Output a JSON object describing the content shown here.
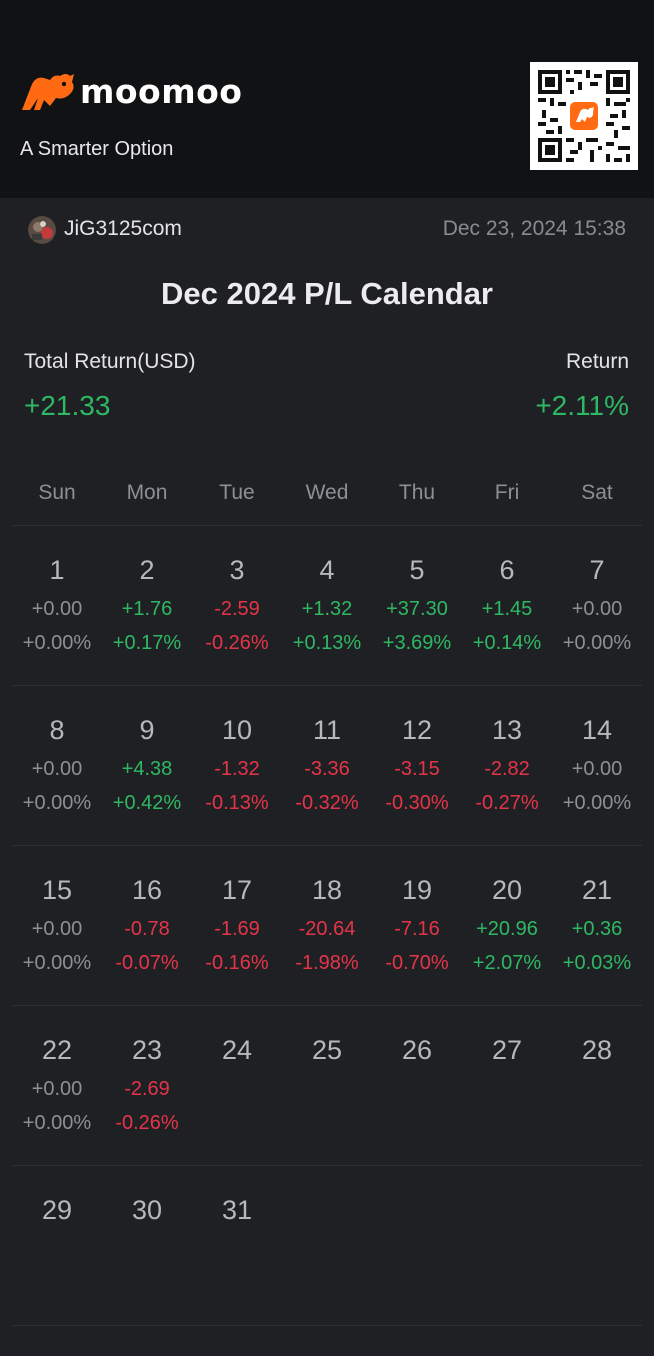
{
  "brand": {
    "name": "moomoo",
    "slogan": "A Smarter Option"
  },
  "user": {
    "name": "JiG3125com",
    "timestamp": "Dec 23, 2024 15:38"
  },
  "title": "Dec 2024 P/L Calendar",
  "summary": {
    "total_label": "Total Return(USD)",
    "total_value": "+21.33",
    "return_label": "Return",
    "return_value": "+2.11%"
  },
  "weekdays": [
    "Sun",
    "Mon",
    "Tue",
    "Wed",
    "Thu",
    "Fri",
    "Sat"
  ],
  "colors": {
    "positive": "#2fb863",
    "negative": "#e5344a",
    "neutral": "#8e8f94",
    "brand": "#ff6a13"
  },
  "weeks": [
    [
      {
        "day": "1",
        "amount": "+0.00",
        "percent": "+0.00%"
      },
      {
        "day": "2",
        "amount": "+1.76",
        "percent": "+0.17%"
      },
      {
        "day": "3",
        "amount": "-2.59",
        "percent": "-0.26%"
      },
      {
        "day": "4",
        "amount": "+1.32",
        "percent": "+0.13%"
      },
      {
        "day": "5",
        "amount": "+37.30",
        "percent": "+3.69%"
      },
      {
        "day": "6",
        "amount": "+1.45",
        "percent": "+0.14%"
      },
      {
        "day": "7",
        "amount": "+0.00",
        "percent": "+0.00%"
      }
    ],
    [
      {
        "day": "8",
        "amount": "+0.00",
        "percent": "+0.00%"
      },
      {
        "day": "9",
        "amount": "+4.38",
        "percent": "+0.42%"
      },
      {
        "day": "10",
        "amount": "-1.32",
        "percent": "-0.13%"
      },
      {
        "day": "11",
        "amount": "-3.36",
        "percent": "-0.32%"
      },
      {
        "day": "12",
        "amount": "-3.15",
        "percent": "-0.30%"
      },
      {
        "day": "13",
        "amount": "-2.82",
        "percent": "-0.27%"
      },
      {
        "day": "14",
        "amount": "+0.00",
        "percent": "+0.00%"
      }
    ],
    [
      {
        "day": "15",
        "amount": "+0.00",
        "percent": "+0.00%"
      },
      {
        "day": "16",
        "amount": "-0.78",
        "percent": "-0.07%"
      },
      {
        "day": "17",
        "amount": "-1.69",
        "percent": "-0.16%"
      },
      {
        "day": "18",
        "amount": "-20.64",
        "percent": "-1.98%"
      },
      {
        "day": "19",
        "amount": "-7.16",
        "percent": "-0.70%"
      },
      {
        "day": "20",
        "amount": "+20.96",
        "percent": "+2.07%"
      },
      {
        "day": "21",
        "amount": "+0.36",
        "percent": "+0.03%"
      }
    ],
    [
      {
        "day": "22",
        "amount": "+0.00",
        "percent": "+0.00%"
      },
      {
        "day": "23",
        "amount": "-2.69",
        "percent": "-0.26%"
      },
      {
        "day": "24",
        "amount": "",
        "percent": ""
      },
      {
        "day": "25",
        "amount": "",
        "percent": ""
      },
      {
        "day": "26",
        "amount": "",
        "percent": ""
      },
      {
        "day": "27",
        "amount": "",
        "percent": ""
      },
      {
        "day": "28",
        "amount": "",
        "percent": ""
      }
    ],
    [
      {
        "day": "29",
        "amount": "",
        "percent": ""
      },
      {
        "day": "30",
        "amount": "",
        "percent": ""
      },
      {
        "day": "31",
        "amount": "",
        "percent": ""
      },
      {
        "day": "",
        "amount": "",
        "percent": ""
      },
      {
        "day": "",
        "amount": "",
        "percent": ""
      },
      {
        "day": "",
        "amount": "",
        "percent": ""
      },
      {
        "day": "",
        "amount": "",
        "percent": ""
      }
    ]
  ]
}
